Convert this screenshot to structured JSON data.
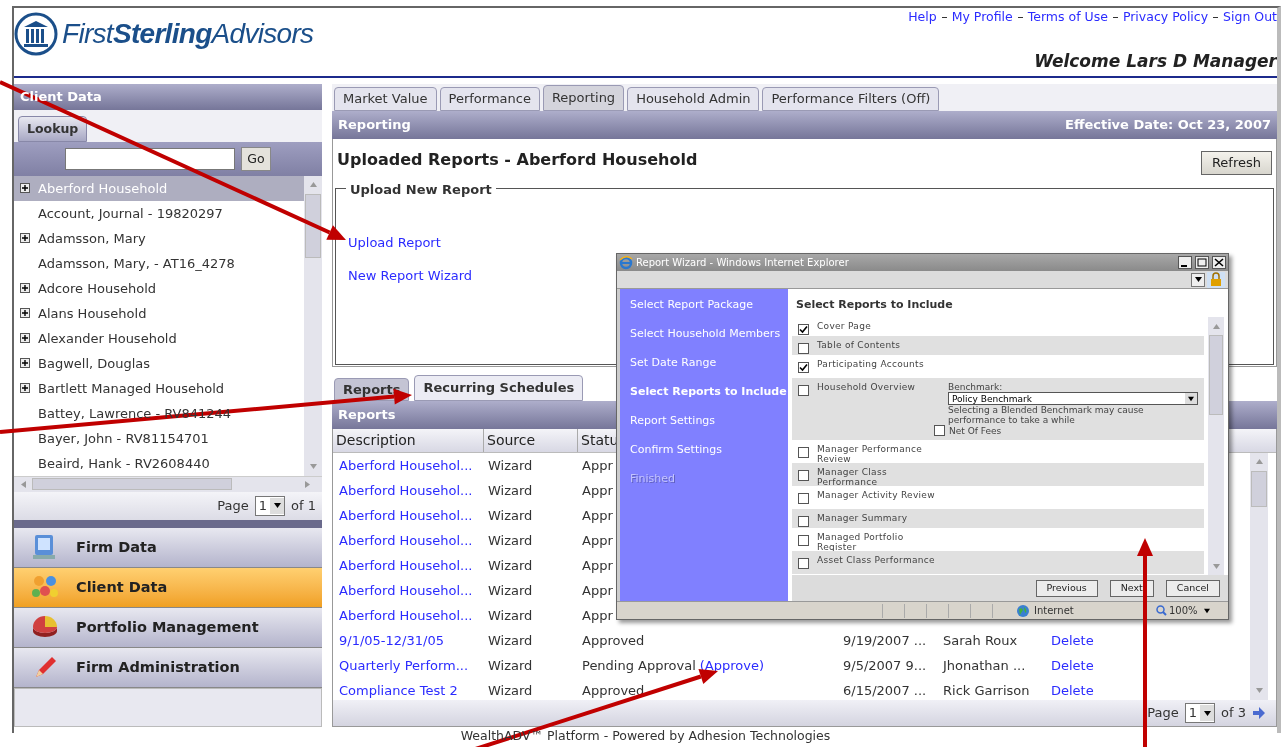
{
  "header": {
    "logo": "First**Sterling**Advisors",
    "links": [
      "Help",
      "My Profile",
      "Terms of Use",
      "Privacy Policy",
      "Sign Out"
    ],
    "welcome": "Welcome Lars D Manager"
  },
  "sidebar": {
    "title": "Client Data",
    "tab": "Lookup",
    "search_button": "Go",
    "items": [
      {
        "label": "Aberford Household",
        "expandable": true,
        "selected": true
      },
      {
        "label": "Account, Journal - 19820297",
        "expandable": false,
        "selected": false
      },
      {
        "label": "Adamsson, Mary",
        "expandable": true,
        "selected": false
      },
      {
        "label": "Adamsson, Mary, - AT16_4278",
        "expandable": false,
        "selected": false
      },
      {
        "label": "Adcore Household",
        "expandable": true,
        "selected": false
      },
      {
        "label": "Alans Household",
        "expandable": true,
        "selected": false
      },
      {
        "label": "Alexander Household",
        "expandable": true,
        "selected": false
      },
      {
        "label": "Bagwell, Douglas",
        "expandable": true,
        "selected": false
      },
      {
        "label": "Bartlett Managed Household",
        "expandable": true,
        "selected": false
      },
      {
        "label": "Battey, Lawrence - RV841244",
        "expandable": false,
        "selected": false
      },
      {
        "label": "Bayer, John - RV81154701",
        "expandable": false,
        "selected": false
      },
      {
        "label": "Beaird, Hank - RV2608440",
        "expandable": false,
        "selected": false
      }
    ],
    "pager": {
      "label": "Page",
      "value": "1",
      "total": "of 1"
    },
    "nav": [
      {
        "kind": "firm",
        "label": "Firm Data",
        "selected": false
      },
      {
        "kind": "client",
        "label": "Client Data",
        "selected": true
      },
      {
        "kind": "portfolio",
        "label": "Portfolio Management",
        "selected": false
      },
      {
        "kind": "admin",
        "label": "Firm Administration",
        "selected": false
      }
    ]
  },
  "main": {
    "tabs": [
      {
        "label": "Market Value",
        "selected": false
      },
      {
        "label": "Performance",
        "selected": false
      },
      {
        "label": "Reporting",
        "selected": true
      },
      {
        "label": "Household Admin",
        "selected": false
      },
      {
        "label": "Performance Filters (Off)",
        "selected": false
      }
    ],
    "bar_title": "Reporting",
    "effective_date": "Effective Date: Oct 23, 2007",
    "heading": "Uploaded Reports - Aberford Household",
    "refresh": "Refresh",
    "upload_legend": "Upload New Report",
    "links": [
      "Upload Report",
      "New Report Wizard"
    ],
    "subtabs": [
      {
        "label": "Reports",
        "selected": true
      },
      {
        "label": "Recurring Schedules",
        "selected": false
      }
    ],
    "reports_title": "Reports",
    "columns": [
      "Description",
      "Source",
      "Statu"
    ],
    "rows": [
      {
        "description": "Aberford Househol...",
        "source": "Wizard",
        "status": "Appr"
      },
      {
        "description": "Aberford Househol...",
        "source": "Wizard",
        "status": "Appr"
      },
      {
        "description": "Aberford Househol...",
        "source": "Wizard",
        "status": "Appr"
      },
      {
        "description": "Aberford Househol...",
        "source": "Wizard",
        "status": "Appr"
      },
      {
        "description": "Aberford Househol...",
        "source": "Wizard",
        "status": "Appr"
      },
      {
        "description": "Aberford Househol...",
        "source": "Wizard",
        "status": "Appr"
      },
      {
        "description": "Aberford Househol...",
        "source": "Wizard",
        "status": "Appr"
      },
      {
        "description": "9/1/05-12/31/05",
        "source": "Wizard",
        "status": "Approved",
        "date": "9/19/2007 ...",
        "user": "Sarah Roux",
        "action": "Delete"
      },
      {
        "description": "Quarterly Perform...",
        "source": "Wizard",
        "status": "Pending Approval",
        "status_link": "(Approve)",
        "date": "9/5/2007 9...",
        "user": "Jhonathan ...",
        "action": "Delete"
      },
      {
        "description": "Compliance Test 2",
        "source": "Wizard",
        "status": "Approved",
        "date": "6/15/2007 ...",
        "user": "Rick Garrison",
        "action": "Delete"
      }
    ],
    "pager": {
      "label": "Page",
      "value": "1",
      "total": "of 3"
    }
  },
  "footer": "WealthADV™ Platform - Powered by Adhesion Technologies",
  "popup": {
    "title": "Report Wizard - Windows Internet Explorer",
    "steps": [
      {
        "label": "Select Report Package",
        "selected": false,
        "disabled": false
      },
      {
        "label": "Select Household Members",
        "selected": false,
        "disabled": false
      },
      {
        "label": "Set Date Range",
        "selected": false,
        "disabled": false
      },
      {
        "label": "Select Reports to Include",
        "selected": true,
        "disabled": false
      },
      {
        "label": "Report Settings",
        "selected": false,
        "disabled": false
      },
      {
        "label": "Confirm Settings",
        "selected": false,
        "disabled": false
      },
      {
        "label": "Finished",
        "selected": false,
        "disabled": true
      }
    ],
    "heading": "Select Reports to Include",
    "reports": [
      {
        "kind": "plain",
        "label": "Cover Page",
        "checked": true
      },
      {
        "kind": "plain",
        "label": "Table of Contents",
        "checked": false
      },
      {
        "kind": "plain",
        "label": "Participating Accounts",
        "checked": true
      },
      {
        "kind": "benchmark",
        "label": "Household Overview",
        "checked": false,
        "benchmark_label": "Benchmark:",
        "benchmark_value": "Policy Benchmark",
        "note": "Selecting a Blended Benchmark may cause performance to take a while",
        "net_of_fees": {
          "label": "Net Of Fees",
          "checked": false
        }
      },
      {
        "kind": "plain",
        "label": "Manager Performance Review",
        "checked": false
      },
      {
        "kind": "plain",
        "label": "Manager Class Performance",
        "checked": false
      },
      {
        "kind": "plain",
        "label": "Manager Activity Review",
        "checked": false
      },
      {
        "kind": "plain",
        "label": "Manager Summary",
        "checked": false
      },
      {
        "kind": "plain",
        "label": "Managed Portfolio Register",
        "checked": false
      },
      {
        "kind": "plain",
        "label": "Asset Class Performance",
        "checked": false
      }
    ],
    "buttons": [
      "Previous",
      "Next",
      "Cancel"
    ],
    "zone": "Internet",
    "zoom": "100%"
  }
}
